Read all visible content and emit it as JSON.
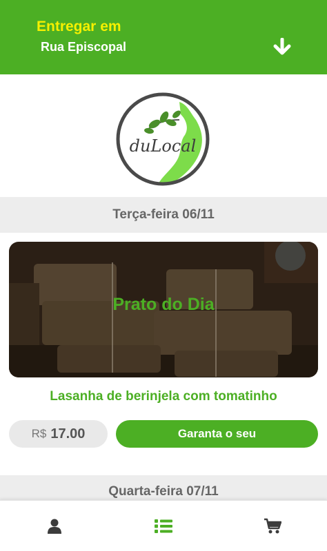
{
  "header": {
    "deliver_label": "Entregar em",
    "address": "Rua Episcopal",
    "dropdown_icon": "arrow-down-icon"
  },
  "logo": {
    "text": "duLocal"
  },
  "days": [
    {
      "label": "Terça-feira 06/11",
      "dish": {
        "badge": "Prato do Dia",
        "name": "Lasanha de berinjela com tomatinho",
        "currency": "R$",
        "price": "17.00",
        "cta": "Garanta o seu"
      }
    },
    {
      "label": "Quarta-feira 07/11"
    }
  ],
  "bottom_nav": [
    {
      "icon": "user-icon",
      "active": false
    },
    {
      "icon": "list-icon",
      "active": true
    },
    {
      "icon": "cart-icon",
      "active": false
    }
  ],
  "colors": {
    "brand_green": "#4caf24",
    "address_yellow": "#f5f000",
    "muted_grey": "#666666"
  }
}
